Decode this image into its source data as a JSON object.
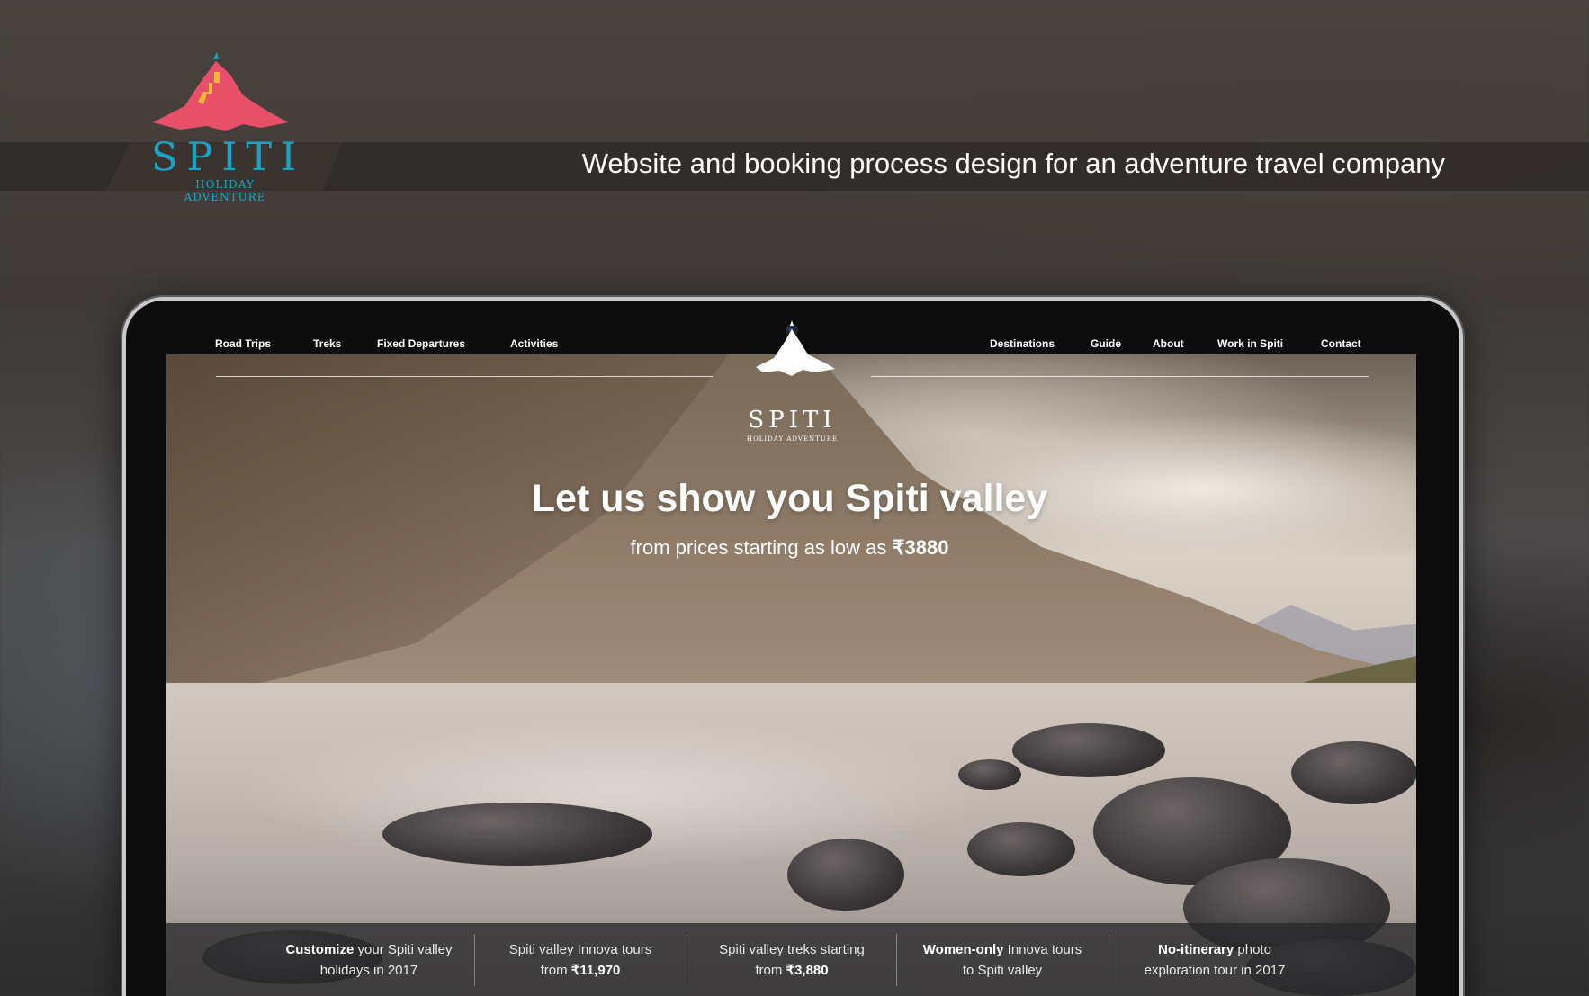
{
  "brand": {
    "name": "SPITI",
    "subtitle": "HOLIDAY ADVENTURE",
    "colors": {
      "peak": "#e8506a",
      "steps": "#f2b736",
      "text": "#1aa3c4"
    }
  },
  "tagline": "Website and booking process design for an adventure travel company",
  "site": {
    "nav_left": [
      "Road Trips",
      "Treks",
      "Fixed Departures",
      "Activities"
    ],
    "nav_right": [
      "Destinations",
      "Guide",
      "About",
      "Work in Spiti",
      "Contact"
    ],
    "logo_word": "SPITI",
    "logo_sub": "HOLIDAY ADVENTURE",
    "headline": "Let us show you Spiti valley",
    "subline_prefix": "from prices starting as low as ",
    "subline_price": "₹3880",
    "promos": [
      {
        "bold": "Customize",
        "line1": " your Spiti valley",
        "line2": "holidays in 2017"
      },
      {
        "bold": "",
        "line1": "Spiti valley Innova tours",
        "line2_prefix": "from ",
        "line2_bold": "₹11,970"
      },
      {
        "bold": "",
        "line1": "Spiti valley treks starting",
        "line2_prefix": "from ",
        "line2_bold": "₹3,880"
      },
      {
        "bold": "Women-only",
        "line1": " Innova tours",
        "line2": "to Spiti valley"
      },
      {
        "bold": "No-itinerary",
        "line1": " photo",
        "line2": "exploration tour in 2017"
      }
    ]
  }
}
